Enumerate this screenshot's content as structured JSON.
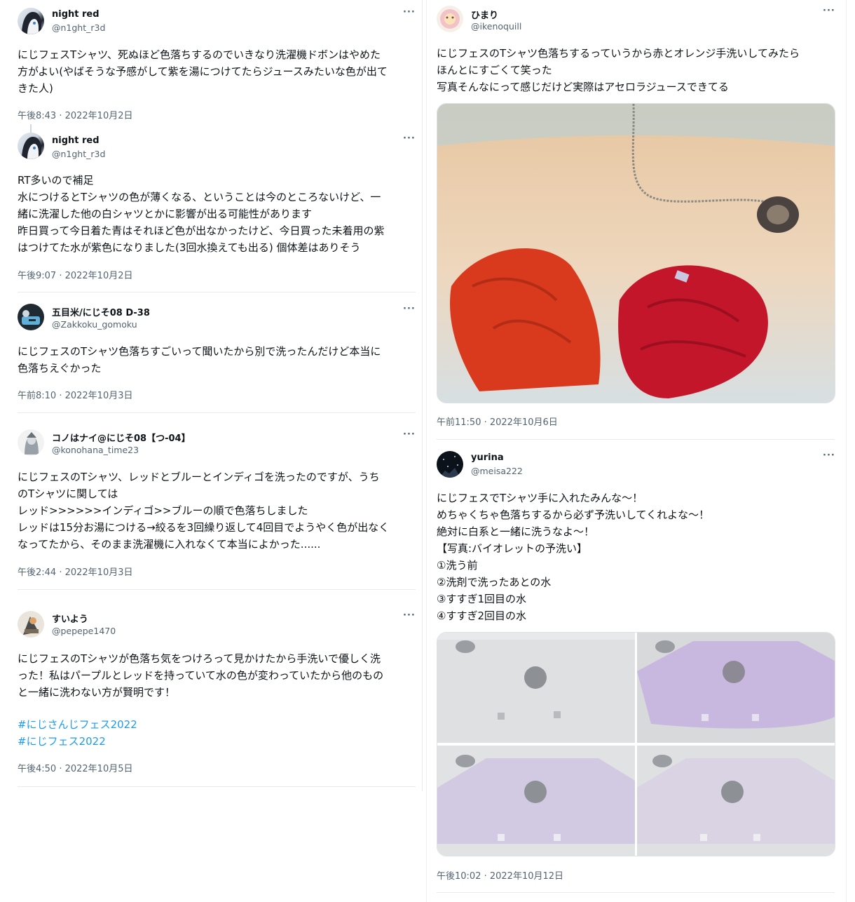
{
  "left": {
    "tweets": [
      {
        "name": "night red",
        "handle": "@n1ght_r3d",
        "text": "にじフェスTシャツ、死ぬほど色落ちするのでいきなり洗濯機ドボンはやめた\n方がよい(やばそうな予感がして紫を湯につけてたらジュースみたいな色が出て\nきた人)",
        "time": "午後8:43 · 2022年10月2日"
      },
      {
        "name": "night red",
        "handle": "@n1ght_r3d",
        "text": "RT多いので補足\n水につけるとTシャツの色が薄くなる、ということは今のところないけど、一\n緒に洗濯した他の白シャツとかに影響が出る可能性があります\n昨日買って今日着た青はそれほど色が出なかったけど、今日買った未着用の紫\nはつけてた水が紫色になりました(3回水換えても出る) 個体差はありそう",
        "time": "午後9:07 · 2022年10月2日"
      },
      {
        "name": "五目米/にじそ08 D-38",
        "handle": "@Zakkoku_gomoku",
        "text": "にじフェスのTシャツ色落ちすごいって聞いたから別で洗ったんだけど本当に\n色落ちえぐかった",
        "time": "午前8:10 · 2022年10月3日"
      },
      {
        "name": "コノはナイ@にじそ08【つ-04】",
        "handle": "@konohana_time23",
        "text": "にじフェスのTシャツ、レッドとブルーとインディゴを洗ったのですが、うち\nのTシャツに関しては\nレッド>>>>>>インディゴ>>ブルーの順で色落ちしました\nレッドは15分お湯につける→絞るを3回繰り返して4回目でようやく色が出なく\nなってたから、そのまま洗濯機に入れなくて本当によかった......",
        "time": "午後2:44 · 2022年10月3日"
      },
      {
        "name": "すいよう",
        "handle": "@pepepe1470",
        "text": "にじフェスのTシャツが色落ち気をつけろって見かけたから手洗いで優しく洗\nった！私はパープルとレッドを持っていて水の色が変わっていたから他のもの\nと一緒に洗わない方が賢明です！",
        "hashtags": [
          "#にじさんじフェス2022",
          "#にじフェス2022"
        ],
        "time": "午後4:50 · 2022年10月5日"
      }
    ]
  },
  "right": {
    "tweets": [
      {
        "name": "ひまり",
        "handle": "@ikenoquill",
        "text": "にじフェスのTシャツ色落ちするっていうから赤とオレンジ手洗いしてみたら\nほんとにすごくて笑った\n写真そんなにって感じだけど実際はアセロラジュースできてる",
        "time": "午前11:50 · 2022年10月6日"
      },
      {
        "name": "yurina",
        "handle": "@meisa222",
        "text": "にじフェスでTシャツ手に入れたみんな〜！\nめちゃくちゃ色落ちするから必ず予洗いしてくれよな〜！\n絶対に白系と一緒に洗うなよ〜！\n【写真:バイオレットの予洗い】\n①洗う前\n②洗剤で洗ったあとの水\n③すすぎ1回目の水\n④すすぎ2回目の水",
        "time": "午後10:02 · 2022年10月12日"
      }
    ]
  },
  "more_glyph": "···",
  "colors": {
    "text": "#0f1419",
    "secondary": "#536471",
    "hashtag": "#1d9bf0",
    "separator": "#e8ebed"
  },
  "icons": [
    "more-options-icon",
    "avatar"
  ]
}
